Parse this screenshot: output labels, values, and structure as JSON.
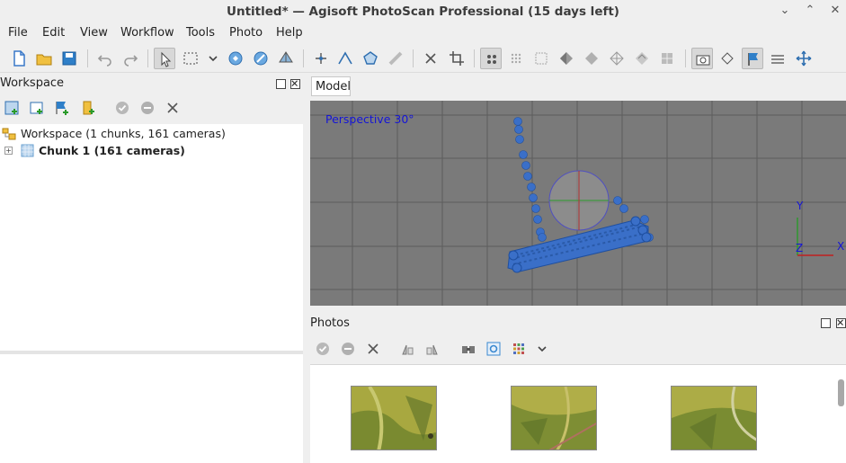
{
  "window": {
    "title": "Untitled* — Agisoft PhotoScan Professional (15 days left)",
    "minimize_glyph": "⌄",
    "maximize_glyph": "⌃",
    "close_glyph": "✕"
  },
  "menu": {
    "items": [
      {
        "label": "File"
      },
      {
        "label": "Edit"
      },
      {
        "label": "View"
      },
      {
        "label": "Workflow"
      },
      {
        "label": "Tools"
      },
      {
        "label": "Photo"
      },
      {
        "label": "Help"
      }
    ]
  },
  "toolbar": {
    "icons": [
      "new-icon",
      "open-icon",
      "save-icon",
      "undo-icon",
      "redo-icon",
      "navigation-icon",
      "rectangle-selection-icon",
      "selection-dropdown-icon",
      "rotate-object-icon",
      "move-object-icon",
      "scale-object-icon",
      "draw-point-icon",
      "draw-polyline-icon",
      "draw-polygon-icon",
      "ruler-icon",
      "delete-icon",
      "crop-icon",
      "point-cloud-icon",
      "dense-cloud-icon",
      "dense-cloud-classes-icon",
      "shaded-model-icon",
      "solid-model-icon",
      "wireframe-model-icon",
      "textured-model-icon",
      "tiled-model-icon",
      "show-cameras-icon",
      "show-shapes-icon",
      "show-markers-icon",
      "show-region-icon",
      "show-trackball-icon"
    ]
  },
  "workspace": {
    "title": "Workspace",
    "tools": [
      "add-chunk-icon",
      "add-photos-icon",
      "add-folder-icon",
      "add-markers-icon",
      "enable-icon",
      "disable-icon",
      "remove-icon"
    ],
    "root_label": "Workspace (1 chunks, 161 cameras)",
    "chunk_label": "Chunk 1 (161 cameras)",
    "expand_glyph": "+"
  },
  "model": {
    "tab_label": "Model",
    "perspective_label": "Perspective 30°",
    "axis_y": "Y",
    "axis_z": "Z",
    "axis_x": "X"
  },
  "photos": {
    "title": "Photos",
    "tools": [
      "enable-icon",
      "disable-icon",
      "remove-icon",
      "rotate-left-icon",
      "rotate-right-icon",
      "find-icon",
      "show-cameras-icon",
      "view-mode-icon",
      "chevron-down-icon"
    ]
  },
  "colors": {
    "viewport_bg": "#7a7a7a",
    "camera_blue": "#3a6fc8",
    "perspective_text": "#1414d8"
  }
}
